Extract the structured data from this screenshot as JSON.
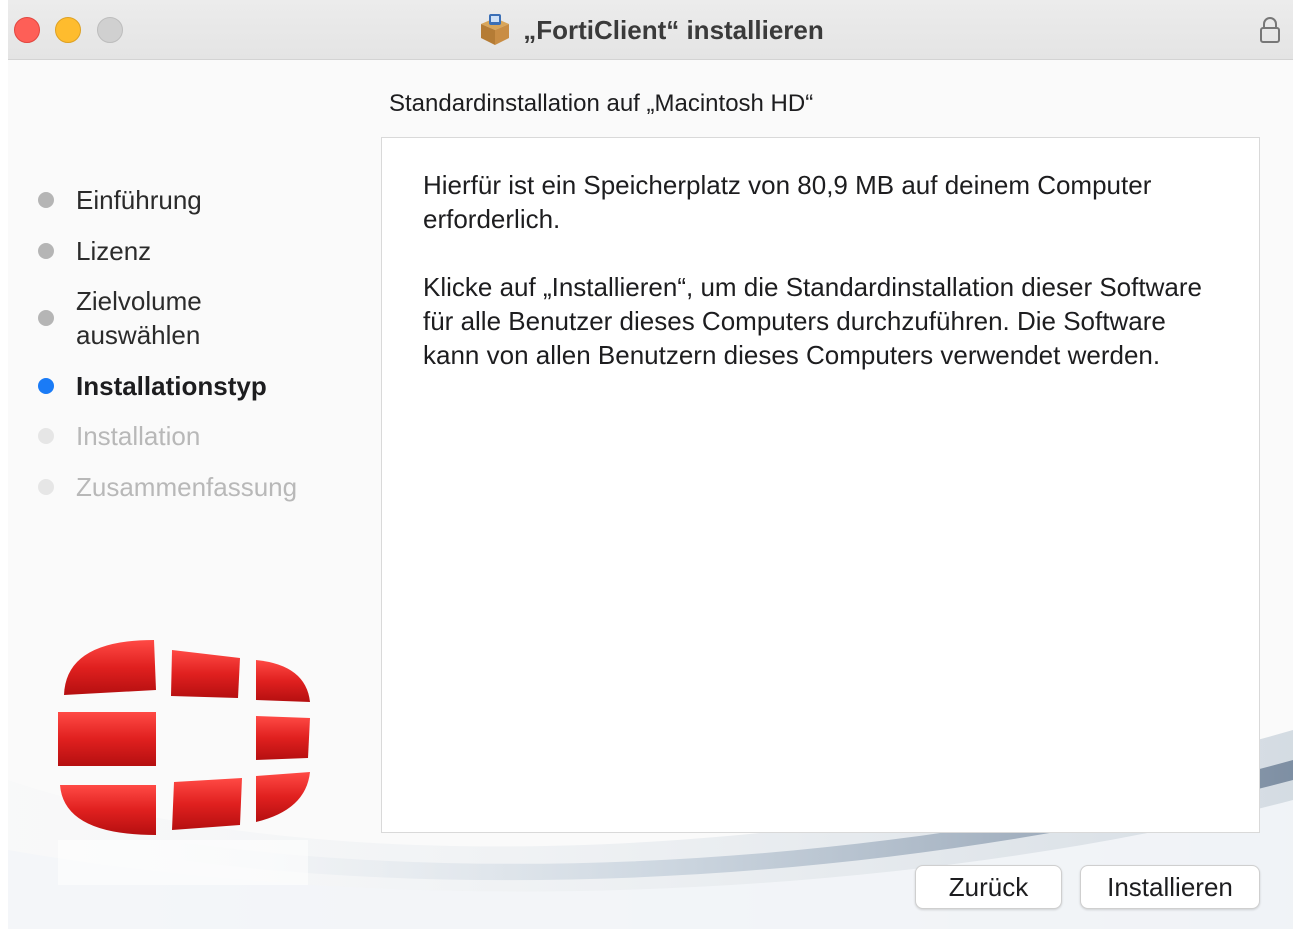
{
  "window": {
    "title": "„FortiClient“ installieren"
  },
  "heading": "Standardinstallation auf „Macintosh HD“",
  "steps": [
    {
      "label": "Einführung",
      "state": "done"
    },
    {
      "label": "Lizenz",
      "state": "done"
    },
    {
      "label": "Zielvolume",
      "label2": "auswählen",
      "state": "done"
    },
    {
      "label": "Installationstyp",
      "state": "active"
    },
    {
      "label": "Installation",
      "state": "future"
    },
    {
      "label": "Zusammenfassung",
      "state": "future"
    }
  ],
  "content": {
    "paragraph1": "Hierfür ist ein Speicherplatz von 80,9 MB auf deinem Computer erforderlich.",
    "paragraph2": "Klicke auf „Installieren“, um die Standardinstallation dieser Software für alle Benutzer dieses Computers durchzuführen. Die Software kann von allen Benutzern dieses Computers verwendet werden."
  },
  "buttons": {
    "back": "Zurück",
    "install": "Installieren"
  },
  "colors": {
    "active_step": "#1a7bf6",
    "close": "#fe5f57",
    "minimize": "#febc2e",
    "brand_red": "#e0201f"
  }
}
